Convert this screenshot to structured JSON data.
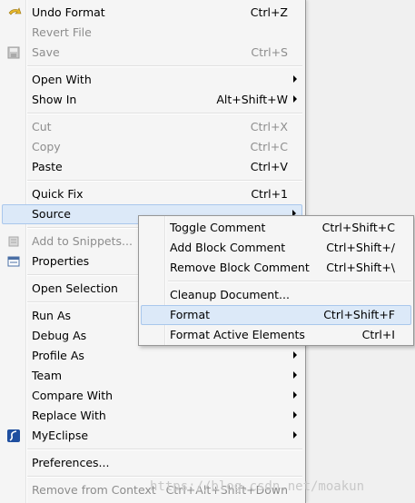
{
  "menu": {
    "undo_format": {
      "label": "Undo Format",
      "shortcut": "Ctrl+Z"
    },
    "revert_file": {
      "label": "Revert File"
    },
    "save": {
      "label": "Save",
      "shortcut": "Ctrl+S"
    },
    "open_with": {
      "label": "Open With"
    },
    "show_in": {
      "label": "Show In",
      "shortcut": "Alt+Shift+W"
    },
    "cut": {
      "label": "Cut",
      "shortcut": "Ctrl+X"
    },
    "copy": {
      "label": "Copy",
      "shortcut": "Ctrl+C"
    },
    "paste": {
      "label": "Paste",
      "shortcut": "Ctrl+V"
    },
    "quick_fix": {
      "label": "Quick Fix",
      "shortcut": "Ctrl+1"
    },
    "source": {
      "label": "Source"
    },
    "add_to_snippets": {
      "label": "Add to Snippets..."
    },
    "properties": {
      "label": "Properties"
    },
    "open_selection": {
      "label": "Open Selection"
    },
    "run_as": {
      "label": "Run As"
    },
    "debug_as": {
      "label": "Debug As"
    },
    "profile_as": {
      "label": "Profile As"
    },
    "team": {
      "label": "Team"
    },
    "compare_with": {
      "label": "Compare With"
    },
    "replace_with": {
      "label": "Replace With"
    },
    "myeclipse": {
      "label": "MyEclipse"
    },
    "preferences": {
      "label": "Preferences..."
    },
    "remove_from_context": {
      "label": "Remove from Context",
      "shortcut": "Ctrl+Alt+Shift+Down"
    }
  },
  "submenu": {
    "toggle_comment": {
      "label": "Toggle Comment",
      "shortcut": "Ctrl+Shift+C"
    },
    "add_block_comment": {
      "label": "Add Block Comment",
      "shortcut": "Ctrl+Shift+/"
    },
    "remove_block_comment": {
      "label": "Remove Block Comment",
      "shortcut": "Ctrl+Shift+\\"
    },
    "cleanup_document": {
      "label": "Cleanup Document..."
    },
    "format": {
      "label": "Format",
      "shortcut": "Ctrl+Shift+F"
    },
    "format_active_elements": {
      "label": "Format Active Elements",
      "shortcut": "Ctrl+I"
    }
  },
  "watermark": "https://blog.csdn.net/moakun",
  "colors": {
    "highlight": "#dce9f8",
    "highlight_border": "#a9c7ec",
    "disabled": "#8d8d8d"
  }
}
